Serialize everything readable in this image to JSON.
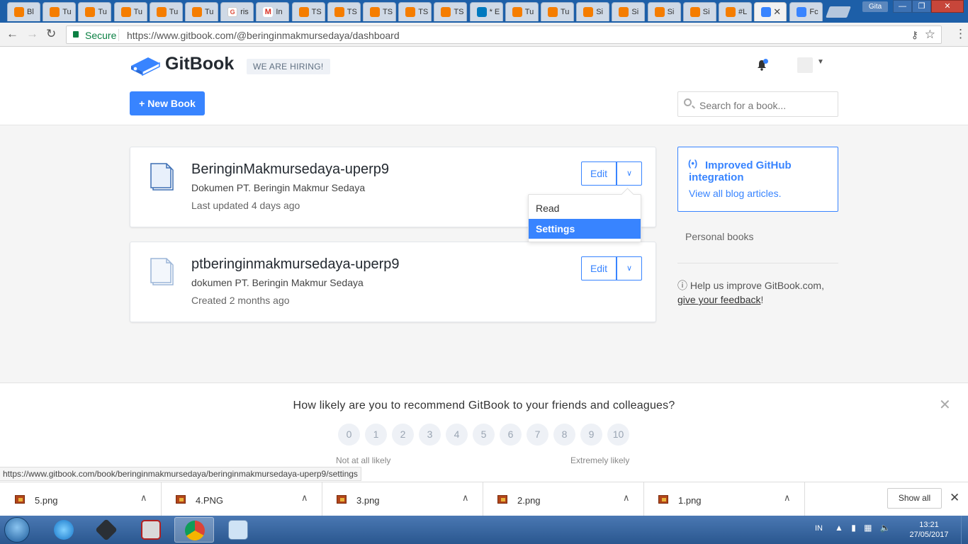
{
  "browser": {
    "tabs": [
      {
        "label": "Bl",
        "icon": "blogger-icon"
      },
      {
        "label": "Tu",
        "icon": "blogger-icon"
      },
      {
        "label": "Tu",
        "icon": "blogger-icon"
      },
      {
        "label": "Tu",
        "icon": "blogger-icon"
      },
      {
        "label": "Tu",
        "icon": "blogger-icon"
      },
      {
        "label": "Tu",
        "icon": "blogger-icon"
      },
      {
        "label": "ris",
        "icon": "google-plus-icon"
      },
      {
        "label": "In",
        "icon": "gmail-icon"
      },
      {
        "label": "TS",
        "icon": "blogger-icon"
      },
      {
        "label": "TS",
        "icon": "blogger-icon"
      },
      {
        "label": "TS",
        "icon": "blogger-icon"
      },
      {
        "label": "TS",
        "icon": "blogger-icon"
      },
      {
        "label": "TS",
        "icon": "blogger-icon"
      },
      {
        "label": "* E",
        "icon": "trello-icon"
      },
      {
        "label": "Tu",
        "icon": "blogger-icon"
      },
      {
        "label": "Tu",
        "icon": "blogger-icon"
      },
      {
        "label": "Si",
        "icon": "blogger-icon"
      },
      {
        "label": "Si",
        "icon": "blogger-icon"
      },
      {
        "label": "Si",
        "icon": "blogger-icon"
      },
      {
        "label": "Si",
        "icon": "blogger-icon"
      },
      {
        "label": "#L",
        "icon": "blogger-icon"
      },
      {
        "label": "",
        "icon": "gitbook-icon",
        "active": true
      },
      {
        "label": "Fc",
        "icon": "gitbook-icon"
      }
    ],
    "user": "Gita",
    "secure_label": "Secure",
    "url": "https://www.gitbook.com/@beringinmakmursedaya/dashboard"
  },
  "header": {
    "logo": "GitBook",
    "hiring": "WE ARE HIRING!",
    "new_book": "+ New Book",
    "search_placeholder": "Search for a book..."
  },
  "books": [
    {
      "title": "BeringinMakmursedaya-uperp9",
      "description": "Dokumen PT. Beringin Makmur Sedaya",
      "meta": "Last updated 4 days ago",
      "edit": "Edit"
    },
    {
      "title": "ptberinginmakmursedaya-uperp9",
      "description": "dokumen PT. Beringin Makmur Sedaya",
      "meta": "Created 2 months ago",
      "edit": "Edit"
    }
  ],
  "dropdown": {
    "read": "Read",
    "settings": "Settings"
  },
  "sidebar": {
    "promo_title": "Improved GitHub integration",
    "promo_link": "View all blog articles.",
    "personal": "Personal books",
    "help_text": "Help us improve GitBook.com,",
    "help_link": "give your feedback",
    "help_end": "!"
  },
  "survey": {
    "question": "How likely are you to recommend GitBook to your friends and colleagues?",
    "scores": [
      "0",
      "1",
      "2",
      "3",
      "4",
      "5",
      "6",
      "7",
      "8",
      "9",
      "10"
    ],
    "low_label": "Not at all likely",
    "high_label": "Extremely likely"
  },
  "status_url": "https://www.gitbook.com/book/beringinmakmursedaya/beringinmakmursedaya-uperp9/settings",
  "downloads": {
    "files": [
      "5.png",
      "4.PNG",
      "3.png",
      "2.png",
      "1.png"
    ],
    "show_all": "Show all"
  },
  "taskbar": {
    "lang": "IN",
    "time": "13:21",
    "date": "27/05/2017"
  },
  "colors": {
    "accent": "#3884ff",
    "taskbar": "#2a578f",
    "tabstrip": "#1d5fa8"
  }
}
